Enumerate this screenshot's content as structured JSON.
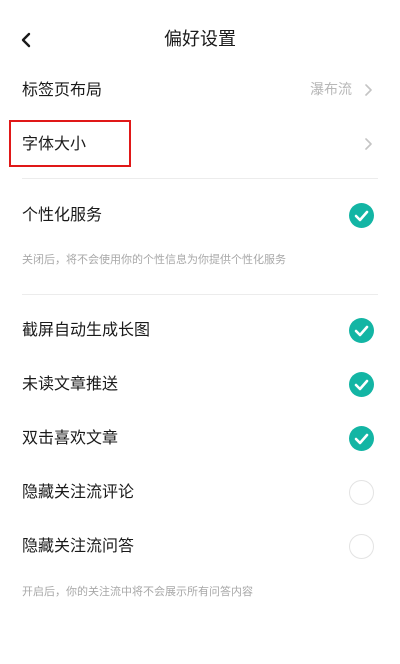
{
  "header": {
    "title": "偏好设置",
    "back_icon": "chevron-left-icon"
  },
  "rows": {
    "tab_layout": {
      "label": "标签页布局",
      "value": "瀑布流"
    },
    "font_size": {
      "label": "字体大小"
    },
    "personalized": {
      "label": "个性化服务",
      "checked": true
    },
    "screenshot_long": {
      "label": "截屏自动生成长图",
      "checked": true
    },
    "unread_push": {
      "label": "未读文章推送",
      "checked": true
    },
    "double_tap_like": {
      "label": "双击喜欢文章",
      "checked": true
    },
    "hide_comments": {
      "label": "隐藏关注流评论",
      "checked": false
    },
    "hide_qa": {
      "label": "隐藏关注流问答",
      "checked": false
    }
  },
  "hints": {
    "personalized": "关闭后，将不会使用你的个性信息为你提供个性化服务",
    "follow_stream": "开启后，你的关注流中将不会展示所有问答内容"
  },
  "colors": {
    "accent": "#13b5a4",
    "highlight": "#e01818"
  }
}
